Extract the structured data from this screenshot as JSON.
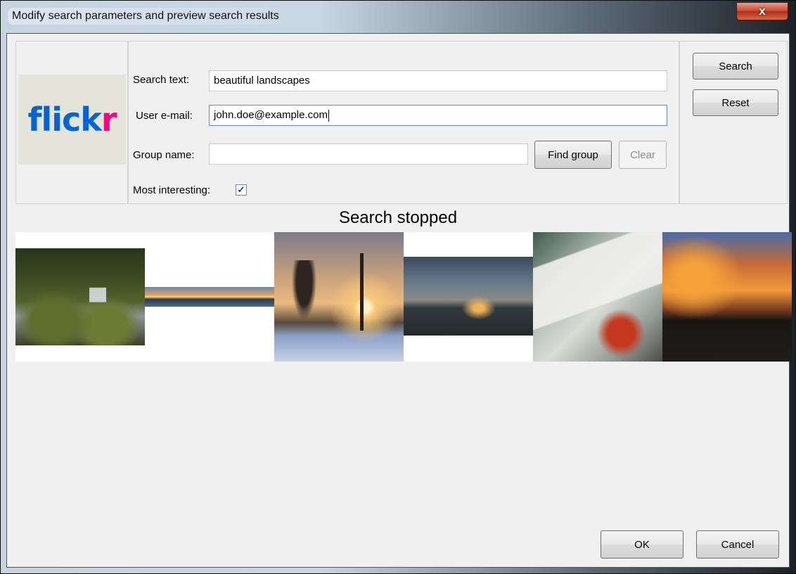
{
  "window": {
    "title": "Modify search parameters and preview search results",
    "close_label": "x"
  },
  "logo": {
    "text_blue": "flick",
    "text_pink": "r"
  },
  "form": {
    "search_text_label": "Search text:",
    "search_text_value": "beautiful landscapes",
    "user_email_label": "User e-mail:",
    "user_email_value": "john.doe@example.com",
    "group_name_label": "Group name:",
    "group_name_value": "",
    "find_group_label": "Find group",
    "clear_label": "Clear",
    "most_interesting_label": "Most interesting:",
    "most_interesting_checked": true
  },
  "side_buttons": {
    "search_label": "Search",
    "reset_label": "Reset"
  },
  "status": {
    "text": "Search stopped"
  },
  "results": [
    {
      "name": "waterfall-photo"
    },
    {
      "name": "panorama-lake-photo"
    },
    {
      "name": "winter-sunset-trees-photo"
    },
    {
      "name": "sunset-horizon-photo"
    },
    {
      "name": "vintage-airplane-photo"
    },
    {
      "name": "fiery-sky-photo"
    }
  ],
  "footer": {
    "ok_label": "OK",
    "cancel_label": "Cancel"
  },
  "colors": {
    "flickr_blue": "#0063dc",
    "flickr_pink": "#ff0084",
    "dialog_bg": "#f0f0f0",
    "close_red": "#c8442c"
  }
}
